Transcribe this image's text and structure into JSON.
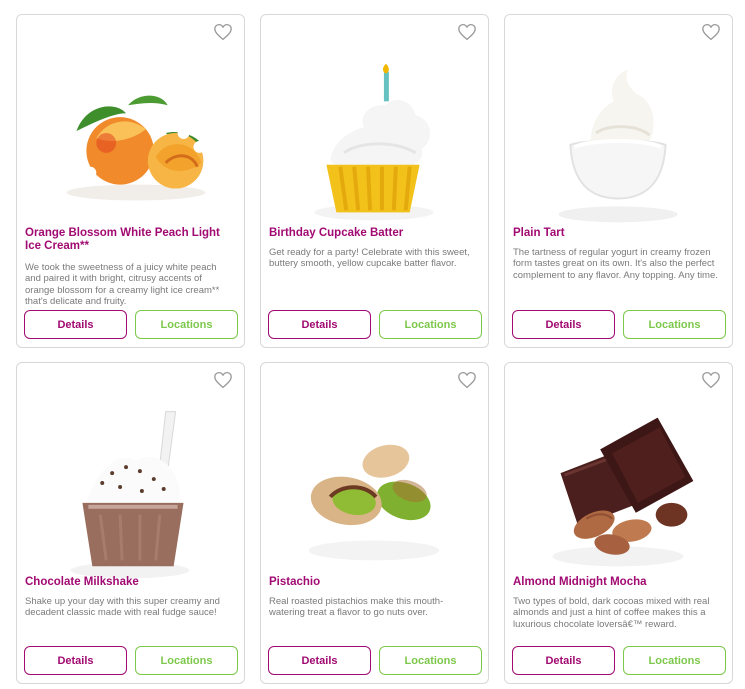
{
  "flavors": [
    {
      "name": "Orange Blossom White Peach Light Ice Cream**",
      "description": "We took the sweetness of a juicy white peach and paired it with bright, citrusy accents of orange blossom for a creamy light ice cream** that's delicate and fruity.",
      "image_icon": "peach-icon",
      "details_label": "Details",
      "locations_label": "Locations"
    },
    {
      "name": "Birthday Cupcake Batter",
      "description": "Get ready for a party! Celebrate with this sweet, buttery smooth, yellow cupcake batter flavor.",
      "image_icon": "cupcake-icon",
      "details_label": "Details",
      "locations_label": "Locations"
    },
    {
      "name": "Plain Tart",
      "description": "The tartness of regular yogurt in creamy frozen form tastes great on its own. It's also the perfect complement to any flavor. Any topping. Any time.",
      "image_icon": "frozen-yogurt-cup-icon",
      "details_label": "Details",
      "locations_label": "Locations"
    },
    {
      "name": "Chocolate Milkshake",
      "description": "Shake up your day with this super creamy and decadent classic made with real fudge sauce!",
      "image_icon": "milkshake-icon",
      "details_label": "Details",
      "locations_label": "Locations"
    },
    {
      "name": "Pistachio",
      "description": "Real roasted pistachios make this mouth-watering treat a flavor to go nuts over.",
      "image_icon": "pistachio-icon",
      "details_label": "Details",
      "locations_label": "Locations"
    },
    {
      "name": "Almond Midnight Mocha",
      "description": "Two types of bold, dark cocoas mixed with real almonds and just a hint of coffee makes this a luxurious chocolate loversâ€™ reward.",
      "image_icon": "chocolate-almond-icon",
      "details_label": "Details",
      "locations_label": "Locations"
    }
  ],
  "colors": {
    "title": "#a10a72",
    "details_border": "#a10a72",
    "locations_border": "#7cc84b",
    "text": "#7a7a7a",
    "card_border": "#d8d8d8"
  }
}
